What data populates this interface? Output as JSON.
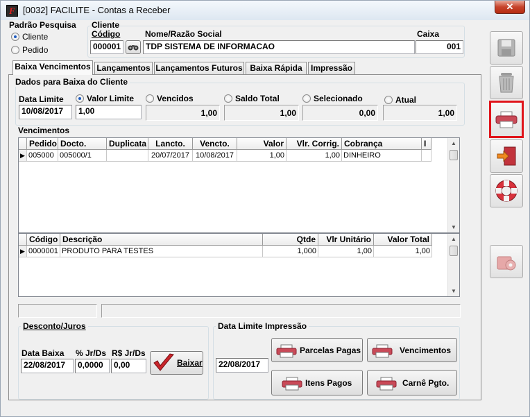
{
  "window": {
    "title": "[0032] FACILITE - Contas a Receber",
    "close_glyph": "✕"
  },
  "padrao": {
    "title": "Padrão Pesquisa",
    "options": [
      "Cliente",
      "Pedido"
    ],
    "selected": "Cliente"
  },
  "cliente": {
    "title": "Cliente",
    "codigo_label": "Código",
    "codigo": "000001",
    "nome_label": "Nome/Razão Social",
    "nome": "TDP SISTEMA DE INFORMACAO",
    "caixa_label": "Caixa",
    "caixa": "001"
  },
  "tabs": [
    "Baixa Vencimentos",
    "Lançamentos",
    "Lançamentos Futuros",
    "Baixa Rápida",
    "Impressão"
  ],
  "dados": {
    "title": "Dados para Baixa do Cliente",
    "data_limite_label": "Data Limite",
    "data_limite": "10/08/2017",
    "options": [
      {
        "label": "Valor Limite",
        "value": "1,00",
        "selected": true
      },
      {
        "label": "Vencidos",
        "value": "1,00",
        "selected": false
      },
      {
        "label": "Saldo Total",
        "value": "1,00",
        "selected": false
      },
      {
        "label": "Selecionado",
        "value": "0,00",
        "selected": false
      },
      {
        "label": "Atual",
        "value": "1,00",
        "selected": false
      }
    ]
  },
  "vencimentos": {
    "title": "Vencimentos",
    "headers": [
      "Pedido",
      "Docto.",
      "Duplicata",
      "Lancto.",
      "Vencto.",
      "Valor",
      "Vlr. Corrig.",
      "Cobrança",
      "I"
    ],
    "rows": [
      {
        "pedido": "005000",
        "docto": "005000/1",
        "duplicata": "",
        "lancto": "20/07/2017",
        "vencto": "10/08/2017",
        "valor": "1,00",
        "vlr_corrig": "1,00",
        "cobranca": "DINHEIRO",
        "i": ""
      }
    ]
  },
  "itens": {
    "headers": [
      "Código",
      "Descrição",
      "Qtde",
      "Vlr Unitário",
      "Valor Total"
    ],
    "rows": [
      {
        "codigo": "0000001",
        "descricao": "PRODUTO PARA TESTES",
        "qtde": "1,000",
        "vlr_unitario": "1,00",
        "valor_total": "1,00"
      }
    ]
  },
  "desconto": {
    "title": "Desconto/Juros",
    "data_baixa_label": "Data Baixa",
    "data_baixa": "22/08/2017",
    "pct_label": "% Jr/Ds",
    "pct": "0,0000",
    "rs_label": "R$ Jr/Ds",
    "rs": "0,00",
    "baixar_label": "Baixar"
  },
  "impressao": {
    "title": "Data Limite Impressão",
    "data": "22/08/2017",
    "buttons": [
      "Parcelas Pagas",
      "Vencimentos",
      "Itens Pagos",
      "Carnê Pgto."
    ]
  },
  "toolbar": {
    "icons": [
      "save-icon",
      "trash-icon",
      "printer-icon",
      "exit-icon",
      "help-lifebuoy-icon",
      "settings-icon"
    ],
    "highlight_color": "#e0141b"
  }
}
